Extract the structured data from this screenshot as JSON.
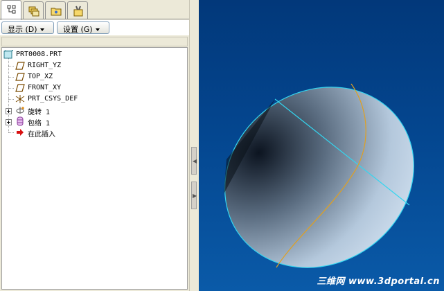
{
  "tabs": [
    {
      "name": "model-tree",
      "icon": "tree-icon",
      "active": true
    },
    {
      "name": "layers",
      "icon": "layers-icon",
      "active": false
    },
    {
      "name": "folder",
      "icon": "folder-icon",
      "active": false
    },
    {
      "name": "favorites",
      "icon": "tools-icon",
      "active": false
    }
  ],
  "menu": {
    "show_label": "显示 (D)",
    "settings_label": "设置 (G)"
  },
  "tree": {
    "root": "PRT0008.PRT",
    "items": [
      {
        "label": "RIGHT_YZ",
        "icon": "datum-plane-icon"
      },
      {
        "label": "TOP_XZ",
        "icon": "datum-plane-icon"
      },
      {
        "label": "FRONT_XY",
        "icon": "datum-plane-icon"
      },
      {
        "label": "PRT_CSYS_DEF",
        "icon": "csys-icon"
      },
      {
        "label": "旋转 1",
        "icon": "revolve-icon"
      },
      {
        "label": "包络 1",
        "icon": "wrap-icon"
      },
      {
        "label": "在此插入",
        "icon": "insert-here-arrow-icon"
      }
    ]
  },
  "viewport": {
    "watermark": "三维网 www.3dportal.cn",
    "background_top": "#02387a",
    "background_bottom": "#0a5aa8",
    "edge_color": "#33d6f0",
    "curve_color": "#e0a020"
  }
}
